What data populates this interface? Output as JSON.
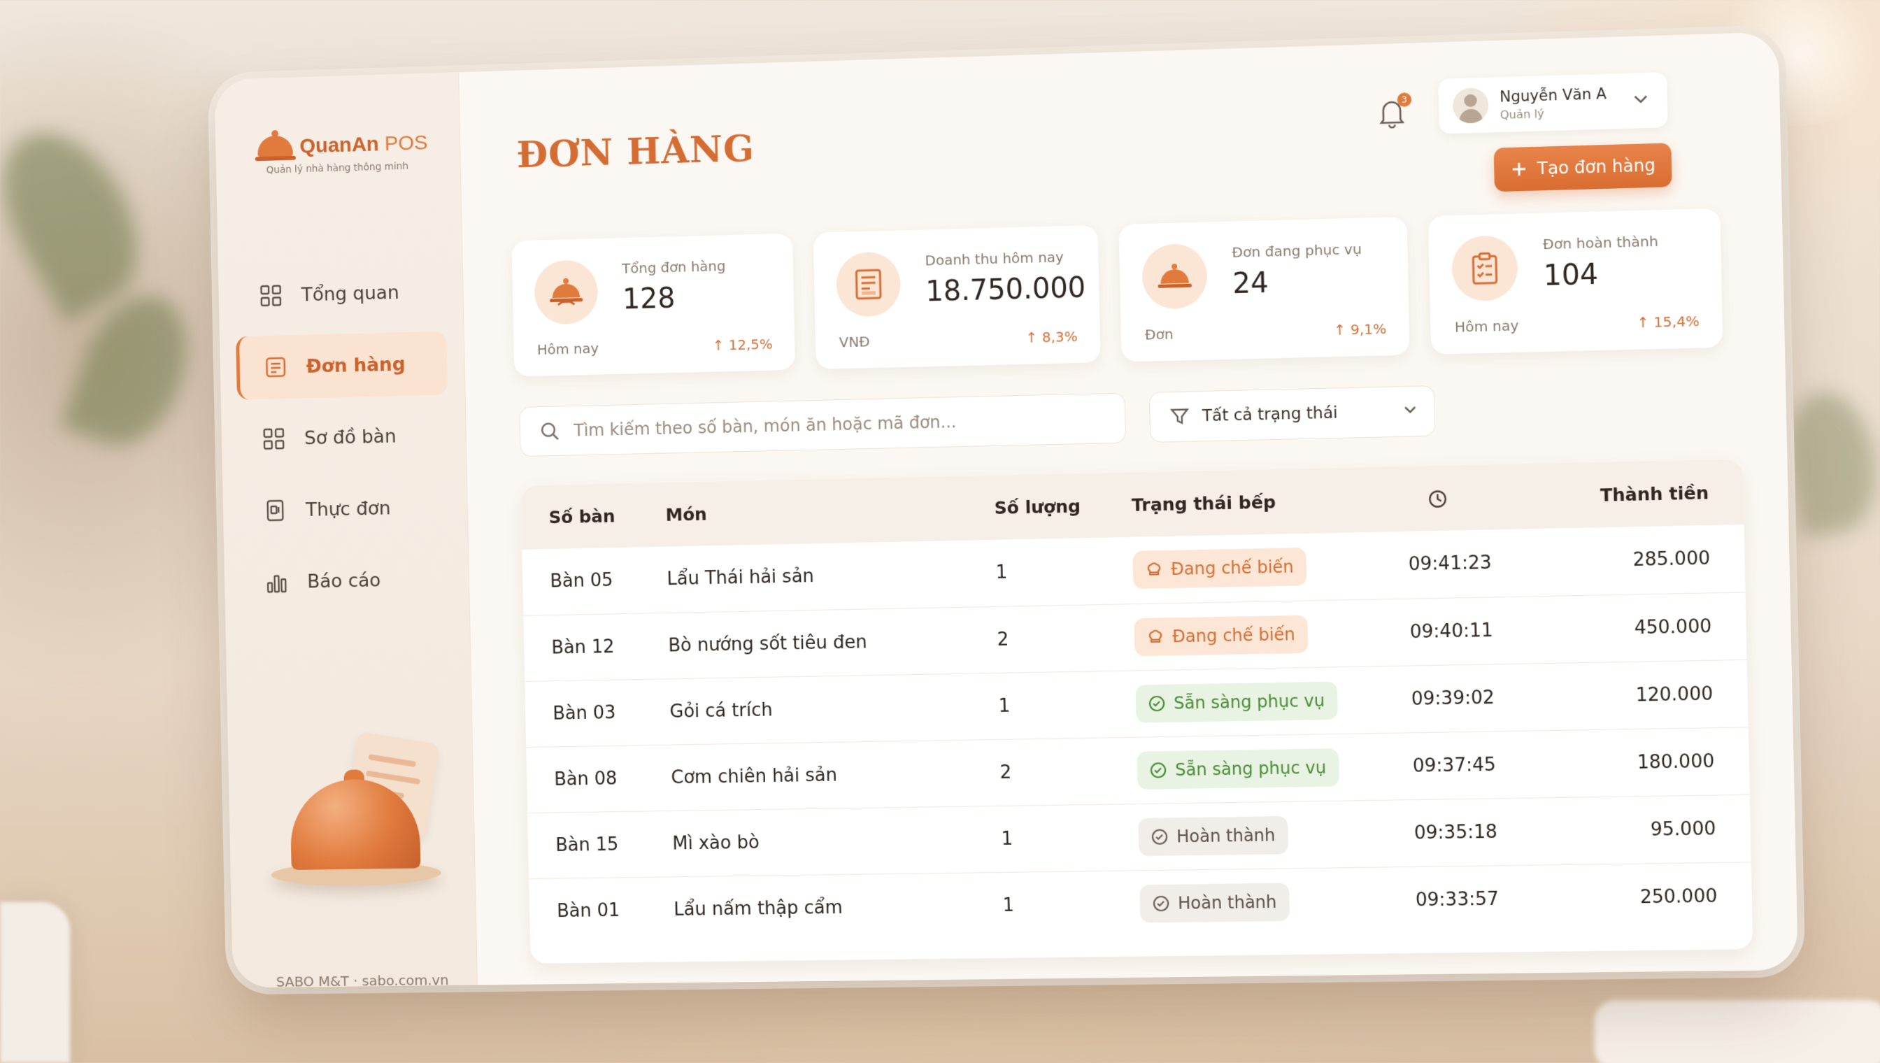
{
  "app": {
    "brand_name": "QuanAn",
    "brand_suffix": "POS",
    "tagline": "Quản lý nhà hàng thông minh",
    "footer": "SABO M&T · sabo.com.vn"
  },
  "sidebar": {
    "items": [
      {
        "label": "Tổng quan",
        "icon": "grid-icon"
      },
      {
        "label": "Đơn hàng",
        "icon": "receipt-icon",
        "active": true
      },
      {
        "label": "Sơ đồ bàn",
        "icon": "table-layout-icon"
      },
      {
        "label": "Thực đơn",
        "icon": "menu-book-icon"
      },
      {
        "label": "Báo cáo",
        "icon": "bar-chart-icon"
      }
    ]
  },
  "header": {
    "title": "ĐƠN HÀNG",
    "notification_count": "3",
    "user_name": "Nguyễn Văn A",
    "user_role": "Quản lý",
    "create_button": "Tạo đơn hàng"
  },
  "stats": [
    {
      "label": "Tổng đơn hàng",
      "value": "128",
      "foot": "Hôm nay",
      "trend": "↑ 12,5%"
    },
    {
      "label": "Doanh thu hôm nay",
      "value": "18.750.000",
      "foot": "VNĐ",
      "trend": "↑ 8,3%"
    },
    {
      "label": "Đơn đang phục vụ",
      "value": "24",
      "foot": "Đơn",
      "trend": "↑ 9,1%"
    },
    {
      "label": "Đơn hoàn thành",
      "value": "104",
      "foot": "Hôm nay",
      "trend": "↑ 15,4%"
    }
  ],
  "search": {
    "placeholder": "Tìm kiếm theo số bàn, món ăn hoặc mã đơn..."
  },
  "filter": {
    "selected": "Tất cả trạng thái"
  },
  "table": {
    "headers": {
      "table": "Số bàn",
      "dish": "Món",
      "qty": "Số lượng",
      "status": "Trạng thái bếp",
      "total": "Thành tiền"
    },
    "rows": [
      {
        "table": "Bàn 05",
        "dish": "Lẩu Thái hải sản",
        "qty": "1",
        "status": "Đang chế biến",
        "status_type": "cooking",
        "time": "09:41:23",
        "total": "285.000"
      },
      {
        "table": "Bàn 12",
        "dish": "Bò nướng sốt tiêu đen",
        "qty": "2",
        "status": "Đang chế biến",
        "status_type": "cooking",
        "time": "09:40:11",
        "total": "450.000"
      },
      {
        "table": "Bàn 03",
        "dish": "Gỏi cá trích",
        "qty": "1",
        "status": "Sẵn sàng phục vụ",
        "status_type": "ready",
        "time": "09:39:02",
        "total": "120.000"
      },
      {
        "table": "Bàn 08",
        "dish": "Cơm chiên hải sản",
        "qty": "2",
        "status": "Sẵn sàng phục vụ",
        "status_type": "ready",
        "time": "09:37:45",
        "total": "180.000"
      },
      {
        "table": "Bàn 15",
        "dish": "Mì xào bò",
        "qty": "1",
        "status": "Hoàn thành",
        "status_type": "done",
        "time": "09:35:18",
        "total": "95.000"
      },
      {
        "table": "Bàn 01",
        "dish": "Lẩu nấm thập cẩm",
        "qty": "1",
        "status": "Hoàn thành",
        "status_type": "done",
        "time": "09:33:57",
        "total": "250.000"
      }
    ]
  },
  "colors": {
    "accent": "#e07a3d",
    "accent_dark": "#d46d33",
    "ready": "#4a8a36"
  }
}
